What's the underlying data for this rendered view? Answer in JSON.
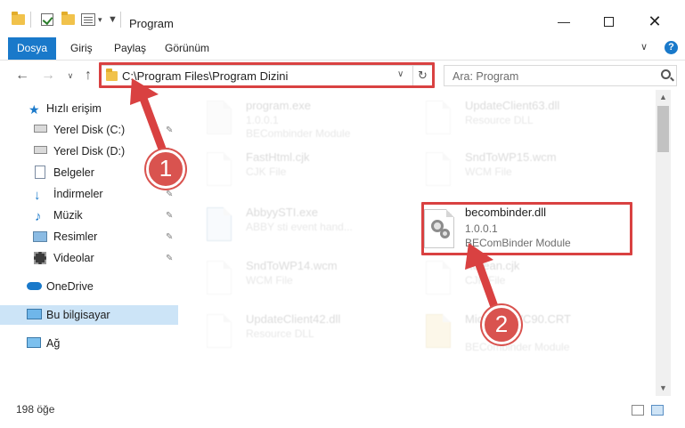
{
  "window": {
    "title": "Program"
  },
  "titlebar": {
    "icons": [
      "folder-icon",
      "properties-icon",
      "new-folder-icon",
      "customize-icon"
    ]
  },
  "ribbon": {
    "tabs": [
      {
        "label": "Dosya",
        "active": true
      },
      {
        "label": "Giriş"
      },
      {
        "label": "Paylaş"
      },
      {
        "label": "Görünüm"
      }
    ]
  },
  "address": {
    "path": "C:\\Program Files\\Program Dizini",
    "search_placeholder": "Ara: Program"
  },
  "sidebar": {
    "items": [
      {
        "label": "Hızlı erişim",
        "icon": "star-icon"
      },
      {
        "label": "Yerel Disk (C:)",
        "icon": "drive-icon",
        "pinned": true
      },
      {
        "label": "Yerel Disk (D:)",
        "icon": "drive-icon",
        "pinned": true
      },
      {
        "label": "Belgeler",
        "icon": "documents-icon",
        "pinned": true
      },
      {
        "label": "İndirmeler",
        "icon": "download-icon",
        "pinned": true
      },
      {
        "label": "Müzik",
        "icon": "music-icon",
        "pinned": true
      },
      {
        "label": "Resimler",
        "icon": "pictures-icon",
        "pinned": true
      },
      {
        "label": "Videolar",
        "icon": "videos-icon",
        "pinned": true
      },
      {
        "label": "OneDrive",
        "icon": "cloud-icon"
      },
      {
        "label": "Bu bilgisayar",
        "icon": "computer-icon",
        "selected": true
      },
      {
        "label": "Ağ",
        "icon": "network-icon"
      }
    ]
  },
  "files": [
    {
      "name": "program.exe",
      "line2": "1.0.0.1",
      "line3": "BECombinder Module",
      "faded": true
    },
    {
      "name": "UpdateClient63.dll",
      "line2": "Resource DLL",
      "faded": true
    },
    {
      "name": "FastHtml.cjk",
      "line2": "CJK File",
      "faded": true
    },
    {
      "name": "SndToWP15.wcm",
      "line2": "WCM File",
      "faded": true
    },
    {
      "name": "AbbyySTI.exe",
      "line2": "ABBY sti event hand...",
      "faded": true
    },
    {
      "name": "becombinder.dll",
      "line2": "1.0.0.1",
      "line3": "BEComBinder Module",
      "faded": false
    },
    {
      "name": "SndToWP14.wcm",
      "line2": "WCM File",
      "faded": true
    },
    {
      "name": "Korean.cjk",
      "line2": "CJK File",
      "faded": true
    },
    {
      "name": "UpdateClient42.dll",
      "line2": "Resource DLL",
      "faded": true
    },
    {
      "name": "Microsoft.VC90.CRT",
      "line2": "",
      "line3": "BECombinder Module",
      "faded": true
    }
  ],
  "status": {
    "count": "198 öğe"
  },
  "callouts": [
    {
      "label": "1"
    },
    {
      "label": "2"
    }
  ],
  "colors": {
    "accent": "#1979ca",
    "highlight": "#d94141",
    "selected": "#cce4f7"
  }
}
